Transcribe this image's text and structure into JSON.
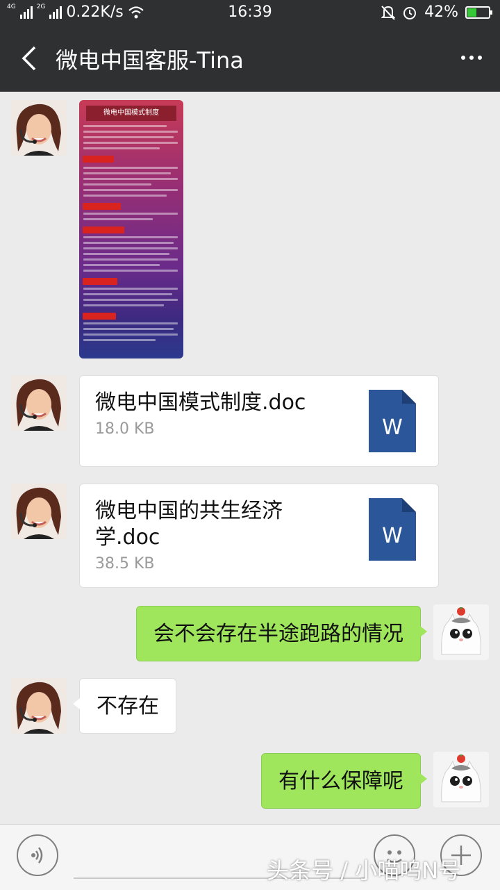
{
  "status_bar": {
    "network_speed": "0.22K/s",
    "net_4g": "4G",
    "net_2g": "2G",
    "time": "16:39",
    "battery": "42%",
    "battery_level": 0.42
  },
  "header": {
    "title": "微电中国客服-Tina"
  },
  "image_message": {
    "heading": "微电中国模式制度"
  },
  "messages": [
    {
      "file_name": "微电中国模式制度.doc",
      "file_size": "18.0 KB",
      "file_icon": "W"
    },
    {
      "file_name": "微电中国的共生经济学.doc",
      "file_size": "38.5 KB",
      "file_icon": "W"
    },
    {
      "text": "会不会存在半途跑路的情况"
    },
    {
      "text": "不存在"
    },
    {
      "text": "有什么保障呢"
    }
  ],
  "watermark": "头条号 / 小喵呜N号",
  "colors": {
    "header_bg": "#2f3031",
    "outgoing_bubble": "#9fe65d",
    "word_icon": "#2b579a"
  }
}
